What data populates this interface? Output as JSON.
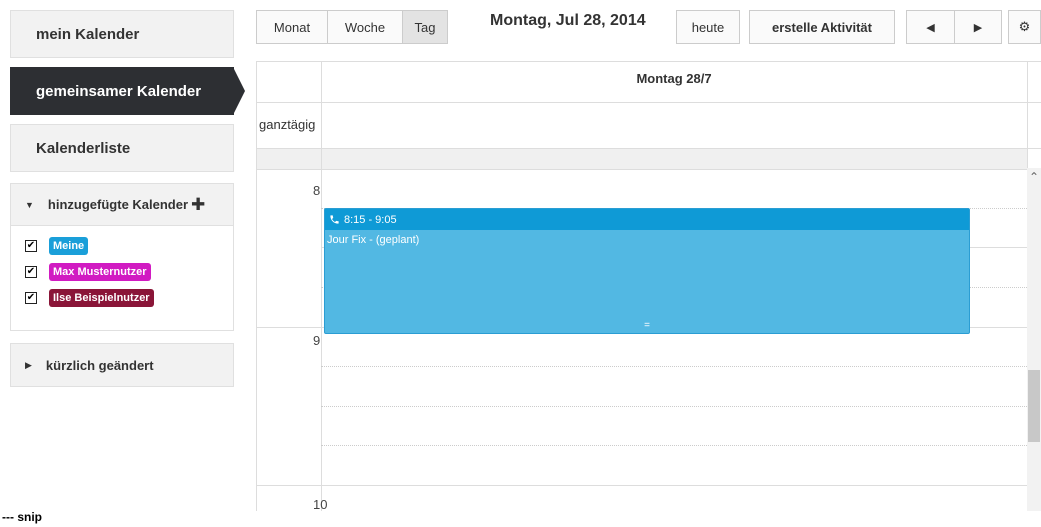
{
  "sidebar": {
    "my_calendar": "mein Kalender",
    "shared_calendar": "gemeinsamer Kalender",
    "calendar_list": "Kalenderliste",
    "added_calendars": {
      "title": "hinzugefügte Kalender",
      "plus": "✚",
      "items": [
        {
          "label": "Meine",
          "color": "#1a9fd9",
          "checked": true
        },
        {
          "label": "Max Musternutzer",
          "color": "#d11bc2",
          "checked": true
        },
        {
          "label": "Ilse Beispielnutzer",
          "color": "#8a1538",
          "checked": true
        }
      ]
    },
    "recently_changed": {
      "title": "kürzlich geändert"
    }
  },
  "toolbar": {
    "views": {
      "month": "Monat",
      "week": "Woche",
      "day": "Tag"
    },
    "active_view": "Tag",
    "date_title": "Montag, Jul 28, 2014",
    "today": "heute",
    "create_activity": "erstelle Aktivität",
    "prev_icon": "◀",
    "next_icon": "▶",
    "settings_icon": "⚙"
  },
  "calendar": {
    "day_header": "Montag 28/7",
    "all_day_label": "ganztägig",
    "hours": [
      "8",
      "9",
      "10"
    ],
    "event": {
      "time": "8:15 - 9:05",
      "title": "Jour Fix - (geplant)",
      "resize_handle": "=",
      "color": "#52b8e3"
    }
  },
  "scroll_up_icon": "⌃",
  "footer_note": "--- snip"
}
